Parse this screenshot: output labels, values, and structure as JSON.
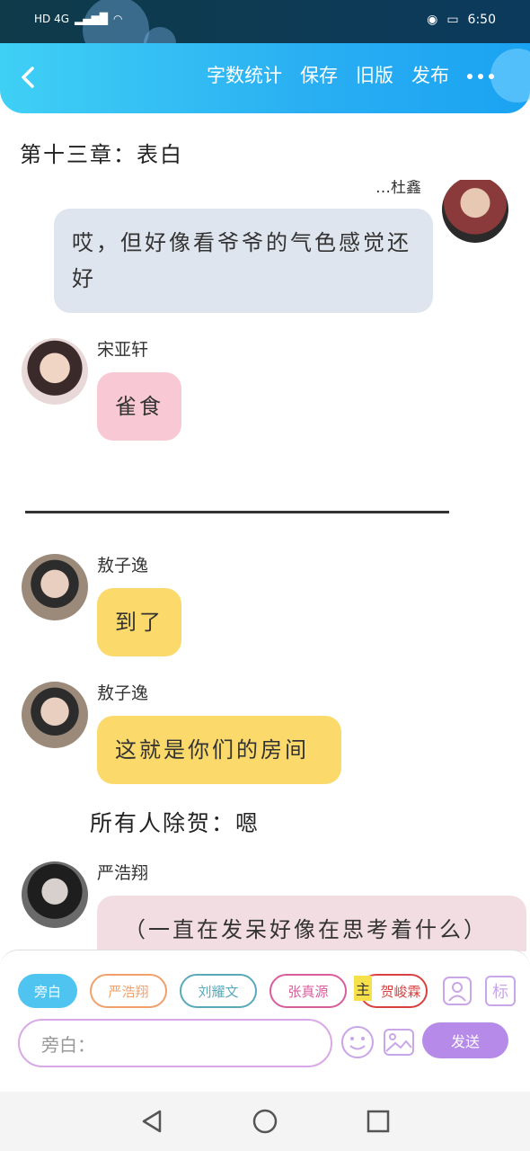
{
  "status_bar": {
    "signal_text": "HD 4G",
    "time": "6:50"
  },
  "header": {
    "actions": [
      "字数统计",
      "保存",
      "旧版",
      "发布"
    ]
  },
  "chapter": {
    "title": "第十三章：表白"
  },
  "messages": [
    {
      "speaker": "…杜鑫",
      "text": "哎，但好像看爷爷的气色感觉还好",
      "side": "right",
      "bubble_color": "#dfe5ee"
    },
    {
      "speaker": "宋亚轩",
      "text": "雀食",
      "side": "left",
      "bubble_color": "#f8c8d4"
    },
    {
      "speaker": "敖子逸",
      "text": "到了",
      "side": "left",
      "bubble_color": "#fbd96a"
    },
    {
      "speaker": "敖子逸",
      "text": "这就是你们的房间",
      "side": "left",
      "bubble_color": "#fbd96a"
    },
    {
      "speaker": "严浩翔",
      "text": "（一直在发呆好像在思考着什么）",
      "side": "left",
      "bubble_color": "#f1dde2"
    }
  ],
  "narration": "所有人除贺：嗯",
  "roles": [
    {
      "label": "旁白",
      "color": "#4fc4f0",
      "filled": true
    },
    {
      "label": "严浩翔",
      "color": "#f0a06a",
      "filled": false
    },
    {
      "label": "刘耀文",
      "color": "#5aa9b8",
      "filled": false
    },
    {
      "label": "张真源",
      "color": "#d85d9a",
      "filled": false
    },
    {
      "label": "贺峻霖",
      "color": "#d94040",
      "filled": false,
      "badge": "主"
    }
  ],
  "input": {
    "placeholder": "旁白："
  },
  "send_label": "发送",
  "tag_button_label": "标"
}
